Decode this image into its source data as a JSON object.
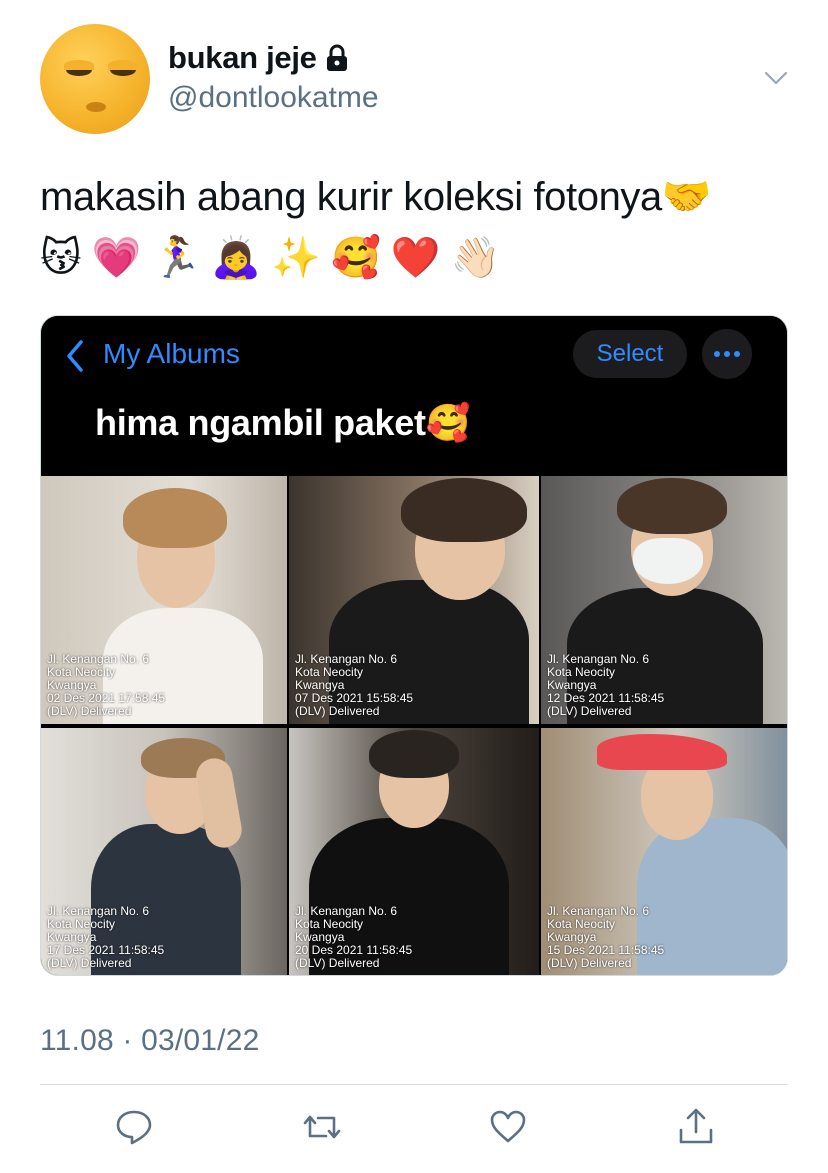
{
  "author": {
    "display_name": "bukan jeje",
    "handle": "@dontlookatme",
    "protected_icon": "lock-icon",
    "avatar_icon": "unamused-face-avatar"
  },
  "tweet": {
    "text": "makasih abang kurir koleksi fotonya🤝",
    "emoji_line": [
      "😽",
      "💗",
      "🏃‍♀️",
      "🙇‍♀️",
      "✨",
      "🥰",
      "❤️",
      "👋🏻"
    ],
    "timestamp": "11.08 · 03/01/22"
  },
  "album": {
    "back_label": "My Albums",
    "select_label": "Select",
    "more_icon": "ellipsis-icon",
    "title": "hima ngambil paket🥰",
    "photos": [
      {
        "lines": [
          "Jl. Kenangan No. 6",
          "Kota Neocity",
          "Kwangya",
          "02 Des 2021 17:58:45",
          "(DLV) Delivered"
        ],
        "bg": "#d9d4cc",
        "hair": "#b88a5a",
        "shirt": "#f4f1ec"
      },
      {
        "lines": [
          "Jl. Kenangan No. 6",
          "Kota Neocity",
          "Kwangya",
          "07 Des 2021 15:58:45",
          "(DLV) Delivered"
        ],
        "bg": "#6a5a4c",
        "hair": "#3a2c22",
        "shirt": "#1b1a1a"
      },
      {
        "lines": [
          "Jl. Kenangan No. 6",
          "Kota Neocity",
          "Kwangya",
          "12 Des 2021 11:58:45",
          "(DLV) Delivered"
        ],
        "bg": "#7b7a78",
        "hair": "#4a3628",
        "shirt": "#1a1a1a"
      },
      {
        "lines": [
          "Jl. Kenangan No. 6",
          "Kota Neocity",
          "Kwangya",
          "17 Des 2021 11:58:45",
          "(DLV) Delivered"
        ],
        "bg": "#cfccc6",
        "hair": "#9b7a55",
        "shirt": "#2c3440"
      },
      {
        "lines": [
          "Jl. Kenangan No. 6",
          "Kota Neocity",
          "Kwangya",
          "20 Des 2021 11:58:45",
          "(DLV) Delivered"
        ],
        "bg": "#3e3833",
        "hair": "#2a2420",
        "shirt": "#101010"
      },
      {
        "lines": [
          "Jl. Kenangan No. 6",
          "Kota Neocity",
          "Kwangya",
          "15 Des 2021 11:58:45",
          "(DLV) Delivered"
        ],
        "bg": "#8b7f6f",
        "hair": "#5b4634",
        "shirt": "#9fb6cc"
      }
    ]
  },
  "actions": [
    {
      "name": "reply-icon"
    },
    {
      "name": "retweet-icon"
    },
    {
      "name": "like-icon"
    },
    {
      "name": "share-icon"
    }
  ],
  "colors": {
    "link_blue": "#2f8bff",
    "secondary_text": "#5b7083",
    "cap_red": "#e8474f"
  }
}
